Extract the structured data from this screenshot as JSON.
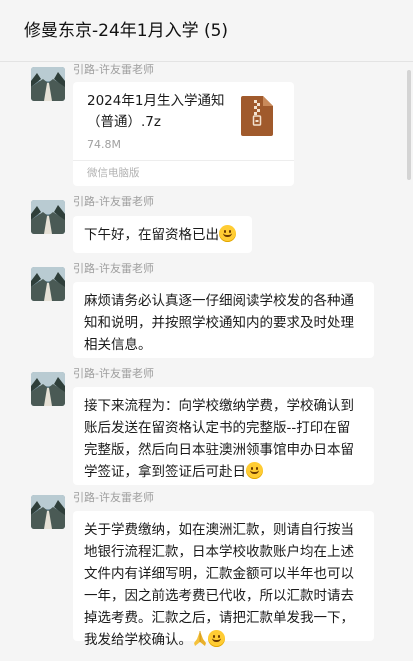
{
  "header": {
    "title": "修曼东京-24年1月入学 (5)"
  },
  "sender_name": "引路-许友雷老师",
  "file": {
    "name": "2024年1月生入学通知（普通）.7z",
    "size": "74.8M",
    "source": "微信电脑版",
    "icon": "zip-archive-icon"
  },
  "messages": [
    {
      "text": "下午好，在留资格已出",
      "trailing_emoji": "smile"
    },
    {
      "text": "麻烦请务必认真逐一仔细阅读学校发的各种通知和说明，并按照学校通知内的要求及时处理相关信息。"
    },
    {
      "text": "接下来流程为：向学校缴纳学费，学校确认到账后发送在留资格认定书的完整版--打印在留完整版，然后向日本驻澳洲领事馆申办日本留学签证，拿到签证后可赴日",
      "trailing_emoji": "smile"
    },
    {
      "text": "关于学费缴纳，如在澳洲汇款，则请自行按当地银行流程汇款，日本学校收款账户均在上述文件内有详细写明，汇款金额可以半年也可以一年，因之前选考费已代收，所以汇款时请去掉选考费。汇款之后，请把汇款单发我一下，我发给学校确认。",
      "trailing_emoji": "pray+smile"
    }
  ]
}
